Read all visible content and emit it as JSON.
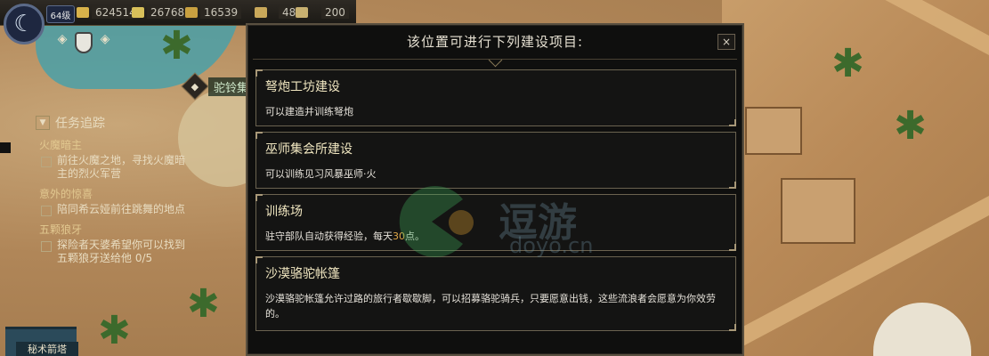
{
  "hud": {
    "level": "64级",
    "resources": [
      {
        "icon": "gold-bar-icon",
        "value": "624514",
        "color": "#d8b24a"
      },
      {
        "icon": "grain-icon",
        "value": "26768",
        "color": "#d8c05a"
      },
      {
        "icon": "coin-icon",
        "value": "16539",
        "color": "#c8a040"
      },
      {
        "icon": "population-icon",
        "value": "48",
        "color": "#c9a85a"
      },
      {
        "icon": "eye-icon",
        "value": "200",
        "color": "#c8b070"
      }
    ]
  },
  "map": {
    "location_label": "驼铃集"
  },
  "quest": {
    "header": "任务追踪",
    "sections": [
      {
        "title": "火魔暗主",
        "items": [
          "前往火魔之地，寻找火魔暗主的烈火军营"
        ]
      },
      {
        "title": "意外的惊喜",
        "items": [
          "陪同希云娅前往跳舞的地点"
        ]
      },
      {
        "title": "五颗狼牙",
        "items": [
          "探险者天婆希望你可以找到五颗狼牙送给他 0/5"
        ]
      }
    ],
    "bottom_label": "秘术箭塔"
  },
  "dialog": {
    "title": "该位置可进行下列建设项目:",
    "close_label": "×",
    "options": [
      {
        "title": "弩炮工坊建设",
        "desc": "可以建造并训练弩炮"
      },
      {
        "title": "巫师集会所建设",
        "desc": "可以训练见习风暴巫师·火"
      },
      {
        "title": "训练场",
        "desc_pre": "驻守部队自动获得经验，每天",
        "desc_num": "30",
        "desc_post": "点。"
      },
      {
        "title": "沙漠骆驼帐篷",
        "desc": "沙漠骆驼帐篷允许过路的旅行者歇歇脚，可以招募骆驼骑兵，只要愿意出钱，这些流浪者会愿意为你效劳的。"
      }
    ]
  },
  "watermark": {
    "main": "逗游",
    "sub": "doyo.cn"
  }
}
